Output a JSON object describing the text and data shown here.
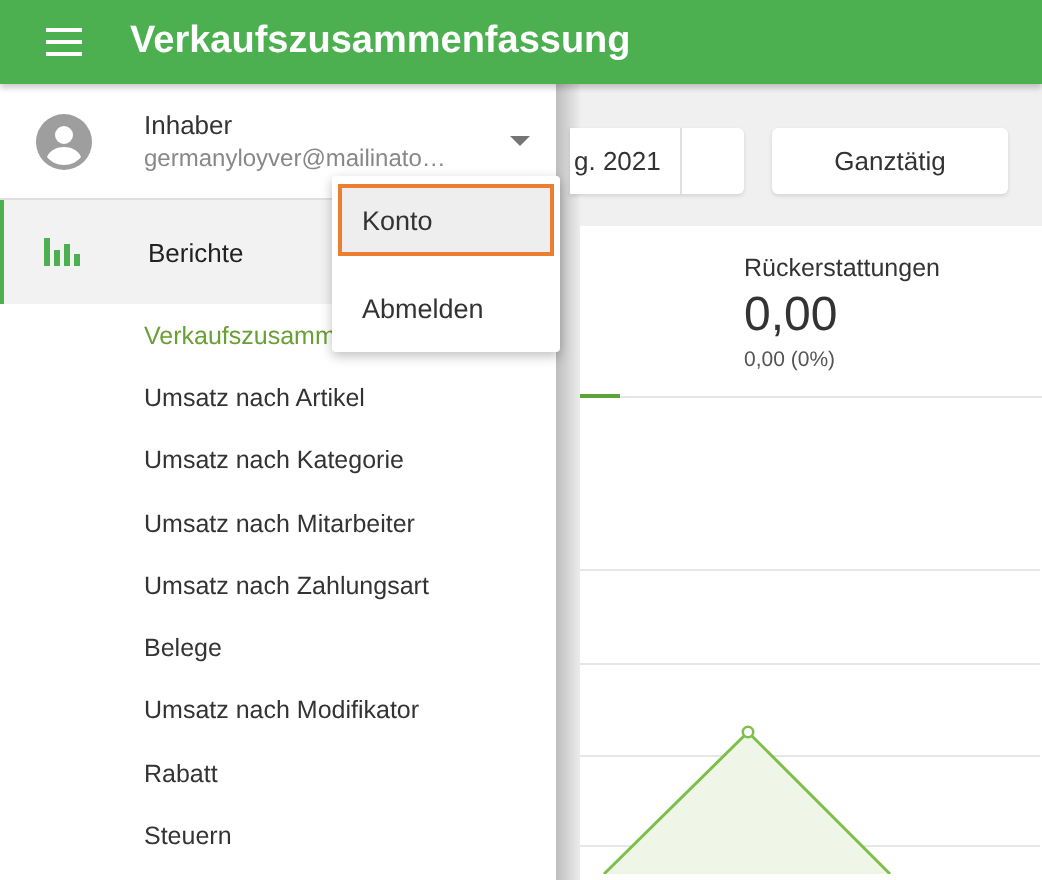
{
  "app_bar": {
    "title": "Verkaufszusammenfassung"
  },
  "account": {
    "role": "Inhaber",
    "email": "germanyloyver@mailinato…",
    "menu_open": true
  },
  "account_menu": [
    {
      "label": "Konto",
      "selected": true
    },
    {
      "label": "Abmelden",
      "selected": false
    }
  ],
  "nav": [
    {
      "label": "Berichte",
      "selected": true,
      "children": [
        {
          "label": "Verkaufszusamm",
          "selected": true
        },
        {
          "label": "Umsatz nach Artikel",
          "selected": false
        },
        {
          "label": "Umsatz nach Kategorie",
          "selected": false
        },
        {
          "label": "Umsatz nach Mitarbeiter",
          "selected": false
        },
        {
          "label": "Umsatz nach Zahlungsart",
          "selected": false
        },
        {
          "label": "Belege",
          "selected": false
        },
        {
          "label": "Umsatz nach Modifikator",
          "selected": false
        },
        {
          "label": "Rabatt",
          "selected": false
        },
        {
          "label": "Steuern",
          "selected": false
        }
      ]
    }
  ],
  "toolbar": {
    "date_range": "g. 2021",
    "time_filter": "Ganztätig"
  },
  "summary": {
    "tabs": [
      {
        "label": "Rückerstattungen",
        "value": "0,00",
        "change": "0,00 (0%)"
      }
    ]
  }
}
